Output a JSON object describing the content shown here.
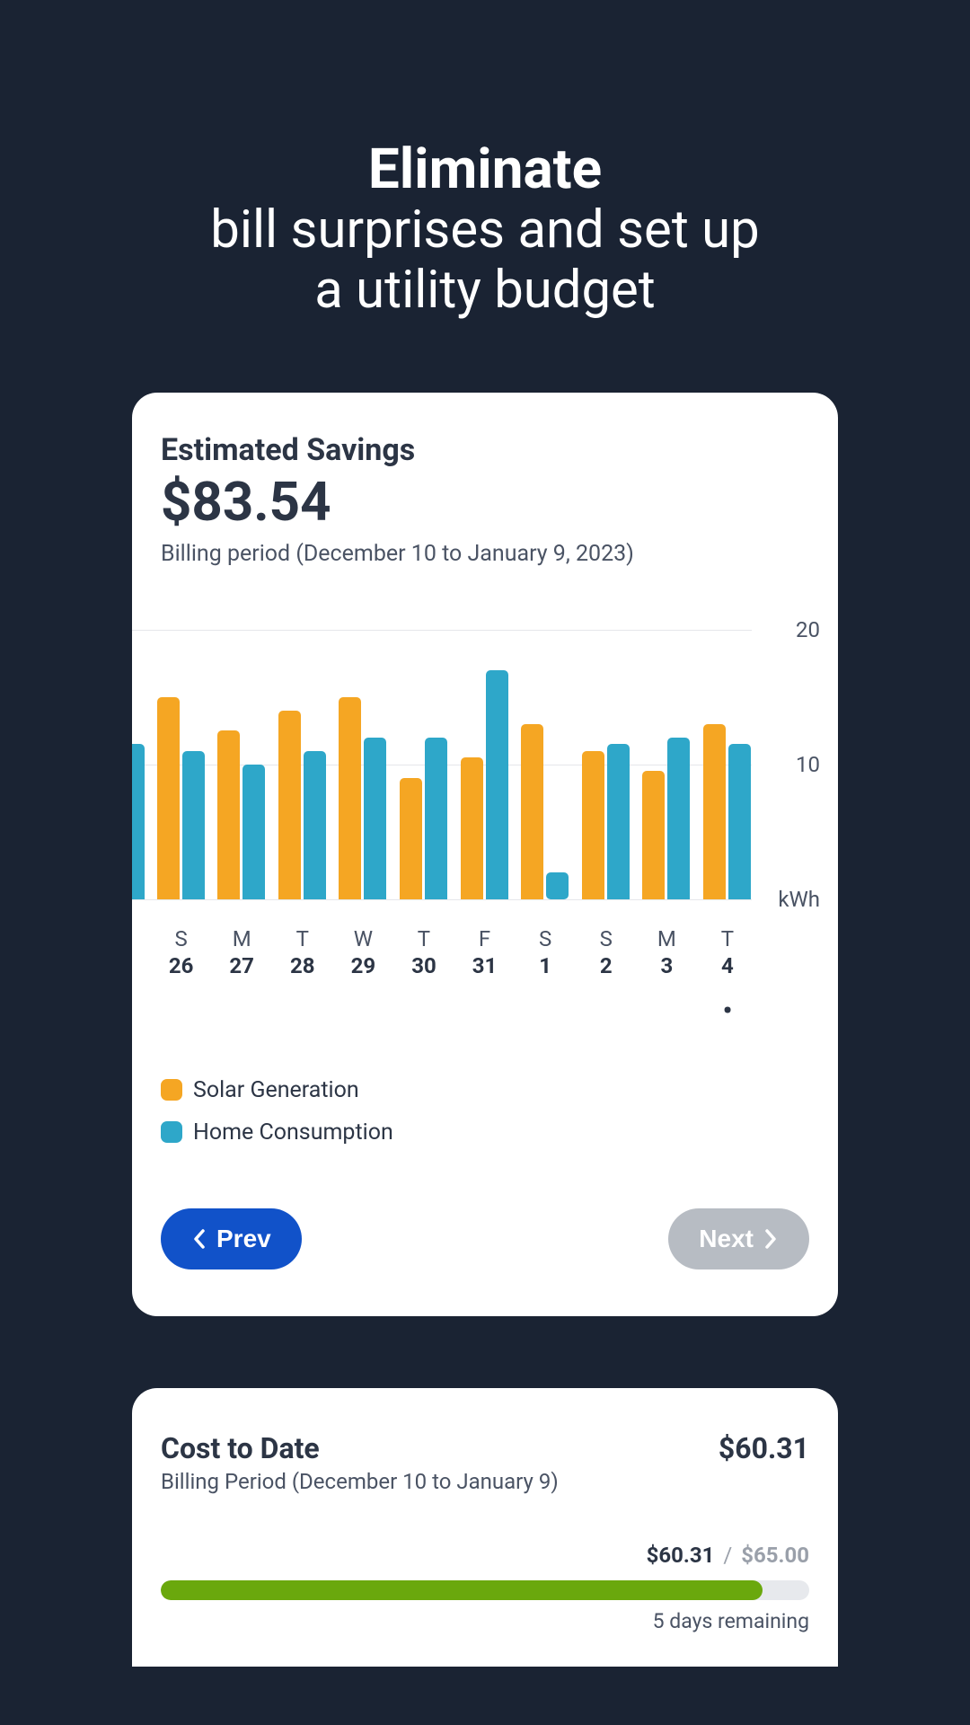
{
  "heading": {
    "bold": "Eliminate",
    "rest1": "bill surprises and set up",
    "rest2": "a utility budget"
  },
  "savings": {
    "label": "Estimated Savings",
    "amount": "$83.54",
    "period": "Billing period (December 10 to January 9, 2023)"
  },
  "chart_data": {
    "type": "bar",
    "ylabel": "kWh",
    "ylim": [
      0,
      20
    ],
    "ticks": [
      "20",
      "10",
      "kWh"
    ],
    "series": [
      {
        "name": "Solar Generation",
        "color": "#f5a623"
      },
      {
        "name": "Home Consumption",
        "color": "#2ea7c9"
      }
    ],
    "categories": [
      {
        "dow": "",
        "date": "",
        "edge": true
      },
      {
        "dow": "S",
        "date": "26"
      },
      {
        "dow": "M",
        "date": "27"
      },
      {
        "dow": "T",
        "date": "28"
      },
      {
        "dow": "W",
        "date": "29"
      },
      {
        "dow": "T",
        "date": "30"
      },
      {
        "dow": "F",
        "date": "31"
      },
      {
        "dow": "S",
        "date": "1"
      },
      {
        "dow": "S",
        "date": "2"
      },
      {
        "dow": "M",
        "date": "3"
      },
      {
        "dow": "T",
        "date": "4",
        "current": true
      }
    ],
    "values": [
      {
        "solar": null,
        "home": 11.5,
        "edge": true
      },
      {
        "solar": 15.0,
        "home": 11.0
      },
      {
        "solar": 12.5,
        "home": 10.0
      },
      {
        "solar": 14.0,
        "home": 11.0
      },
      {
        "solar": 15.0,
        "home": 12.0
      },
      {
        "solar": 9.0,
        "home": 12.0
      },
      {
        "solar": 10.5,
        "home": 17.0
      },
      {
        "solar": 13.0,
        "home": 2.0,
        "stub": true
      },
      {
        "solar": 11.0,
        "home": 11.5
      },
      {
        "solar": 9.5,
        "home": 12.0
      },
      {
        "solar": 13.0,
        "home": 11.5
      }
    ]
  },
  "legend": {
    "solar": "Solar Generation",
    "home": "Home Consumption"
  },
  "pager": {
    "prev": "Prev",
    "next": "Next"
  },
  "cost": {
    "label": "Cost to Date",
    "value": "$60.31",
    "period": "Billing Period (December 10 to January 9)",
    "current": "$60.31",
    "total": "$65.00",
    "percent": 92.8,
    "remaining": "5 days remaining"
  }
}
